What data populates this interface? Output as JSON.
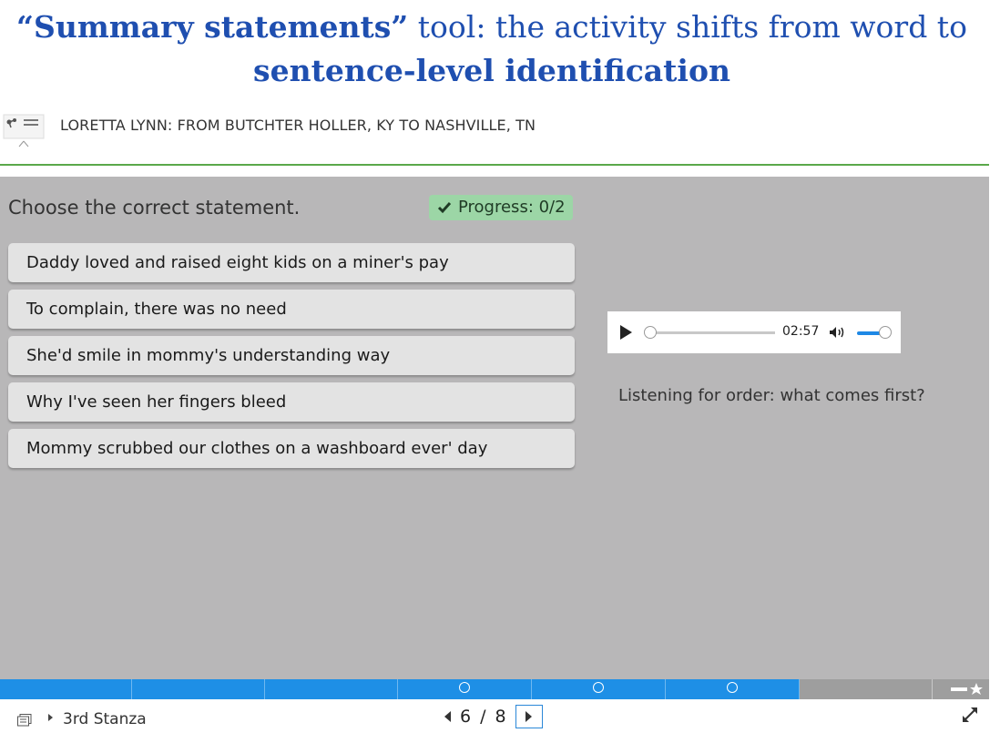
{
  "slide_title": {
    "part1_bold": "“Summary statements”",
    "part2": " tool: the activity shifts from word to",
    "part3_bold": "sentence-level identification"
  },
  "header": {
    "title": "LORETTA LYNN: FROM BUTCHTER HOLLER, KY TO NASHVILLE, TN"
  },
  "activity": {
    "prompt": "Choose the correct statement.",
    "progress_label": "Progress: 0/2",
    "options": [
      "Daddy loved and raised eight kids on a miner's pay",
      "To complain, there was no need",
      "She'd smile in mommy's understanding way",
      "Why I've seen her fingers bleed",
      "Mommy scrubbed our clothes on a washboard ever' day"
    ],
    "hint": "Listening for order: what comes first?"
  },
  "audio": {
    "time": "02:57",
    "playback_progress": 0,
    "volume_level": 0.8
  },
  "footer": {
    "section": "3rd Stanza",
    "current_page": "6",
    "separator": "/",
    "total_pages": "8"
  },
  "colors": {
    "title": "#1f4fb0",
    "accent_blue": "#1e8fe6",
    "progress_green": "#9cd6a6",
    "header_rule": "#5aa84a"
  }
}
